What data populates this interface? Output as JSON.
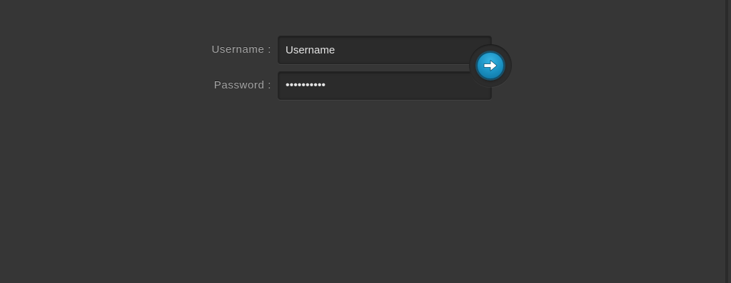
{
  "login": {
    "username_label": "Username :",
    "password_label": "Password :",
    "username_value": "Username",
    "password_value": "••••••••••",
    "submit_icon": "arrow-right-icon"
  },
  "colors": {
    "background": "#363636",
    "input_background": "#2b2b2b",
    "label_text": "#a3a3a3",
    "button_accent": "#1a8fc0"
  }
}
